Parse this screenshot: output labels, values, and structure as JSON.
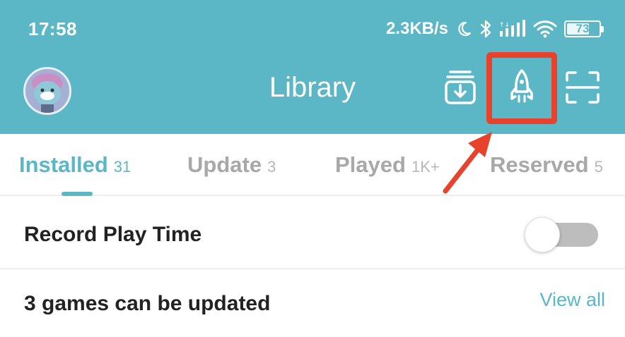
{
  "status_bar": {
    "time": "17:58",
    "network_speed": "2.3KB/s",
    "battery_level": "73",
    "icons": [
      "moon-icon",
      "bluetooth-icon",
      "signal-icon",
      "wifi-icon",
      "battery-icon"
    ]
  },
  "header": {
    "title": "Library",
    "actions": [
      "download-icon",
      "rocket-icon",
      "scan-icon"
    ]
  },
  "tabs": [
    {
      "label": "Installed",
      "count": "31",
      "active": true
    },
    {
      "label": "Update",
      "count": "3",
      "active": false
    },
    {
      "label": "Played",
      "count": "1K+",
      "active": false
    },
    {
      "label": "Reserved",
      "count": "5",
      "active": false
    }
  ],
  "record_play_time": {
    "label": "Record Play Time",
    "enabled": false
  },
  "updates": {
    "label": "3 games can be updated",
    "view_all": "View all"
  },
  "colors": {
    "primary": "#5bb7c5",
    "highlight": "#e8412c",
    "text": "#222222",
    "muted": "#a8a8a8"
  }
}
